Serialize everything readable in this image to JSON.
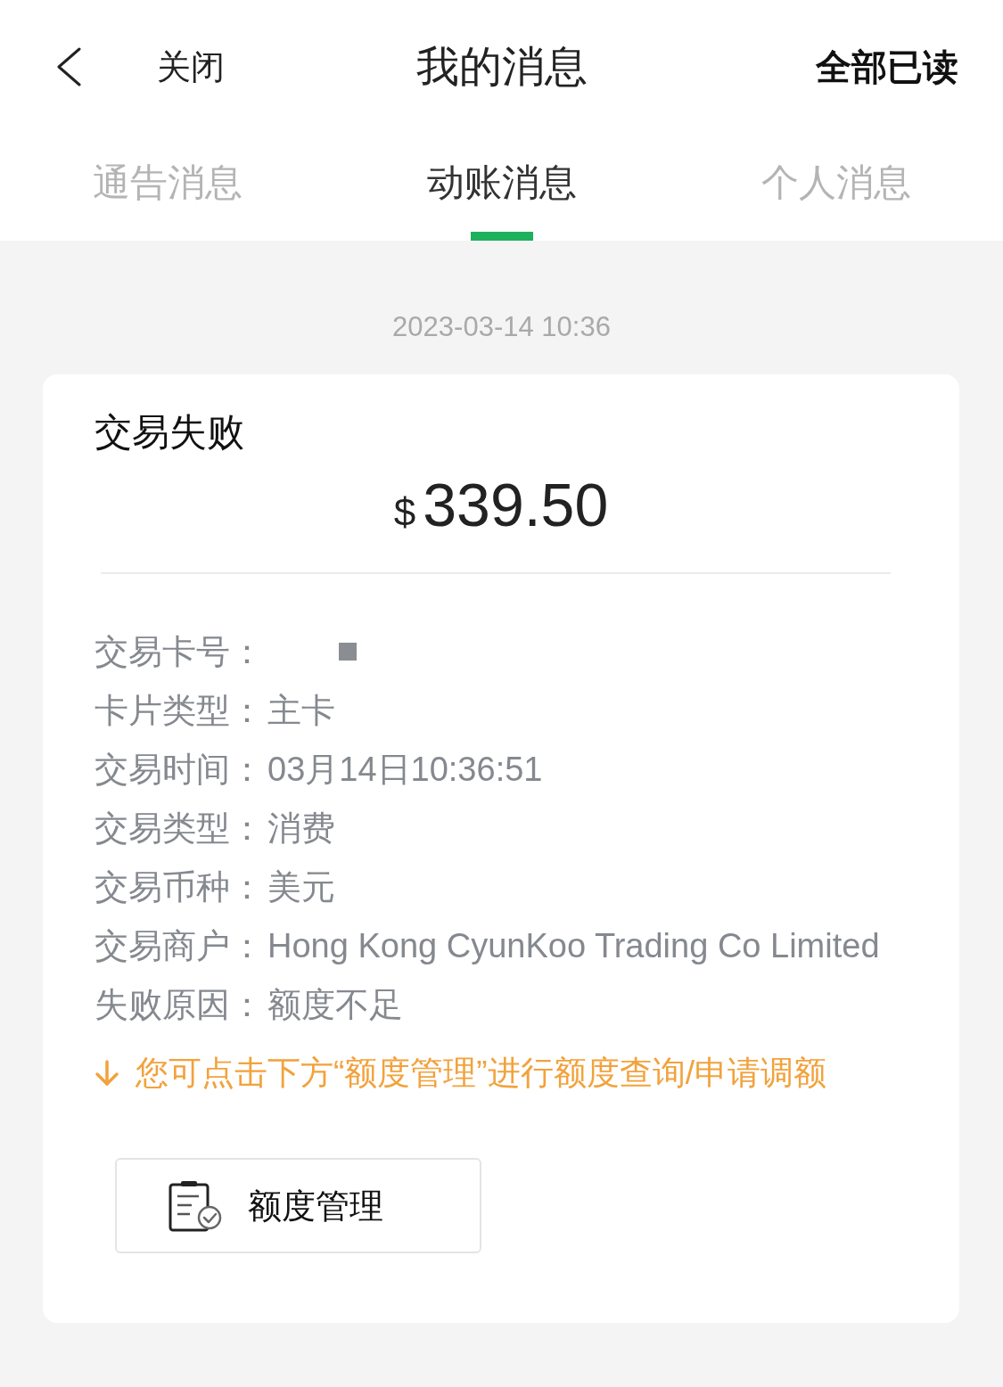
{
  "header": {
    "close_label": "关闭",
    "title": "我的消息",
    "mark_all_read": "全部已读"
  },
  "tabs": [
    {
      "label": "通告消息",
      "selected": false
    },
    {
      "label": "动账消息",
      "selected": true
    },
    {
      "label": "个人消息",
      "selected": false
    }
  ],
  "timestamp": "2023-03-14 10:36",
  "message_card": {
    "title": "交易失败",
    "currency_symbol": "$",
    "amount": "339.50",
    "details": [
      {
        "kind": "masked",
        "label": "交易卡号："
      },
      {
        "kind": "text",
        "label": "卡片类型：",
        "value": "主卡"
      },
      {
        "kind": "text",
        "label": "交易时间：",
        "value": "03月14日10:36:51"
      },
      {
        "kind": "text",
        "label": "交易类型：",
        "value": "消费"
      },
      {
        "kind": "text",
        "label": "交易币种：",
        "value": "美元"
      },
      {
        "kind": "text",
        "label": "交易商户：",
        "value": "Hong Kong CyunKoo Trading Co Limited"
      },
      {
        "kind": "text",
        "label": "失败原因：",
        "value": "额度不足"
      }
    ],
    "hint": "您可点击下方“额度管理”进行额度查询/申请调额",
    "button": "额度管理"
  }
}
